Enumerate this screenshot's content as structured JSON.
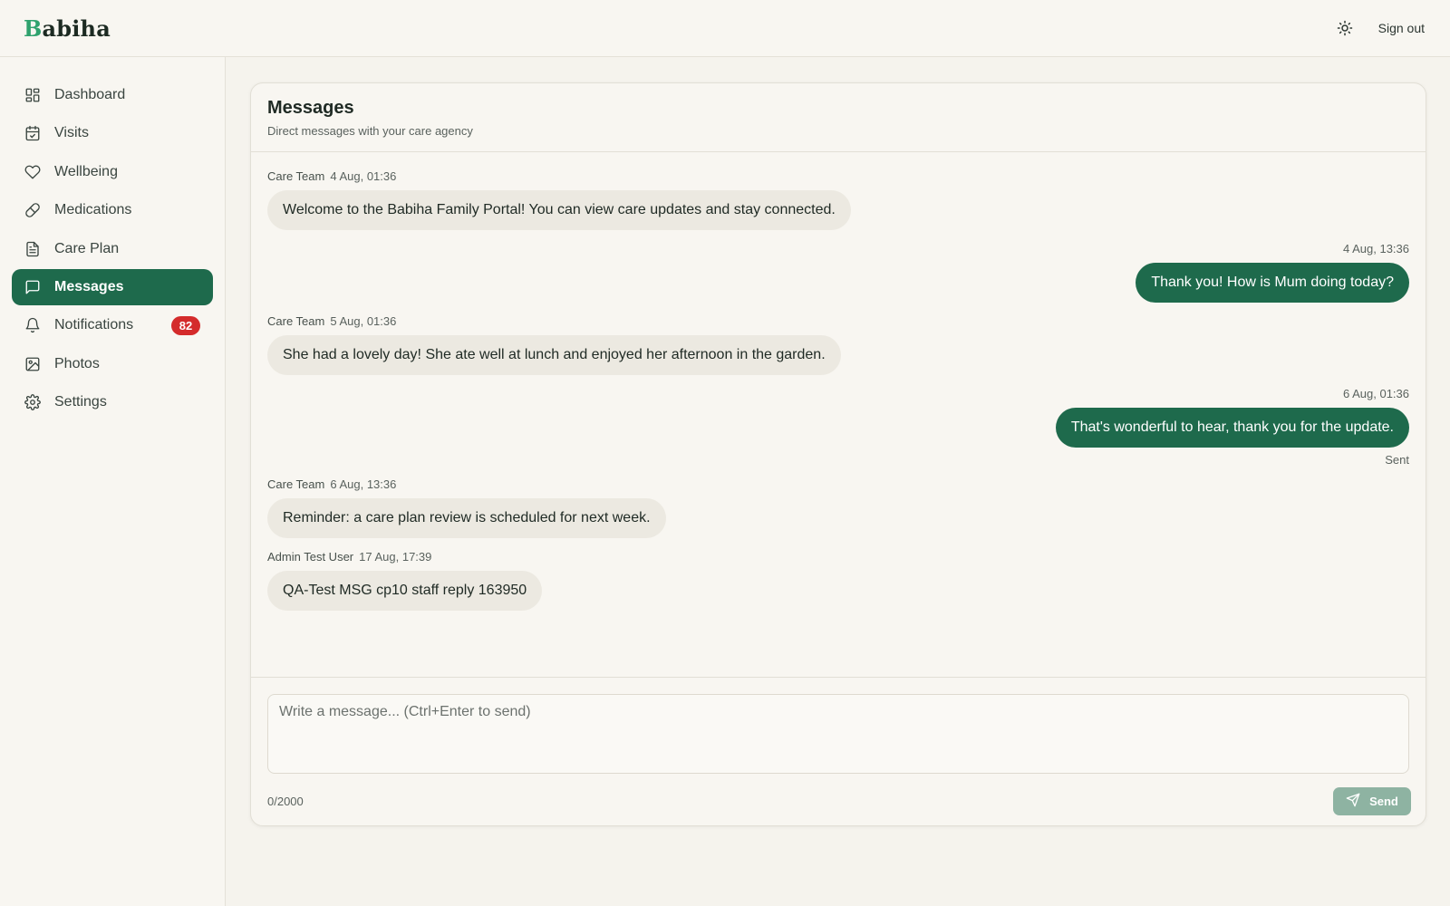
{
  "app": {
    "logo_first": "B",
    "logo_rest": "abiha",
    "sign_out": "Sign out",
    "theme_icon": "sun-icon"
  },
  "sidebar": {
    "items": [
      {
        "label": "Dashboard",
        "icon": "dashboard-icon"
      },
      {
        "label": "Visits",
        "icon": "calendar-check-icon"
      },
      {
        "label": "Wellbeing",
        "icon": "heart-icon"
      },
      {
        "label": "Medications",
        "icon": "pill-icon"
      },
      {
        "label": "Care Plan",
        "icon": "document-icon"
      },
      {
        "label": "Messages",
        "icon": "message-square-icon",
        "active": true
      },
      {
        "label": "Notifications",
        "icon": "bell-icon",
        "badge": "82"
      },
      {
        "label": "Photos",
        "icon": "image-icon"
      },
      {
        "label": "Settings",
        "icon": "gear-icon"
      }
    ]
  },
  "page": {
    "title": "Messages",
    "subtitle": "Direct messages with your care agency"
  },
  "messages": [
    {
      "direction": "in",
      "sender": "Care Team",
      "time": "4 Aug, 01:36",
      "text": "Welcome to the Babiha Family Portal! You can view care updates and stay connected."
    },
    {
      "direction": "out",
      "time": "4 Aug, 13:36",
      "text": "Thank you! How is Mum doing today?"
    },
    {
      "direction": "in",
      "sender": "Care Team",
      "time": "5 Aug, 01:36",
      "text": "She had a lovely day! She ate well at lunch and enjoyed her afternoon in the garden."
    },
    {
      "direction": "out",
      "time": "6 Aug, 01:36",
      "text": "That's wonderful to hear, thank you for the update.",
      "status": "Sent"
    },
    {
      "direction": "in",
      "sender": "Care Team",
      "time": "6 Aug, 13:36",
      "text": "Reminder: a care plan review is scheduled for next week."
    },
    {
      "direction": "in",
      "sender": "Admin Test User",
      "time": "17 Aug, 17:39",
      "text": "QA-Test MSG cp10 staff reply 163950"
    }
  ],
  "composer": {
    "placeholder": "Write a message... (Ctrl+Enter to send)",
    "value": "",
    "counter": "0/2000",
    "send_label": "Send",
    "send_icon": "send-icon"
  },
  "colors": {
    "brand": "#1e6a4c",
    "logo_accent": "#2fa26e",
    "badge": "#d42b2b",
    "send_disabled": "#8eb3a2"
  }
}
